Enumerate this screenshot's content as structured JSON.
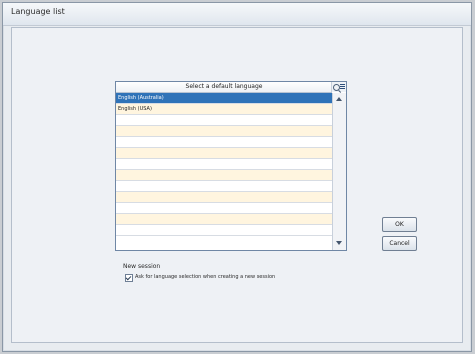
{
  "window": {
    "title": "Language list"
  },
  "language_list": {
    "header": "Select a default language",
    "items": [
      "English (Australia)",
      "English (USA)",
      "",
      "",
      "",
      "",
      "",
      "",
      "",
      "",
      "",
      "",
      ""
    ],
    "selected_index": 0
  },
  "new_session": {
    "title": "New session",
    "checkbox_label": "Ask for language selection when creating a new session",
    "checked": true
  },
  "buttons": {
    "ok": "OK",
    "cancel": "Cancel"
  }
}
